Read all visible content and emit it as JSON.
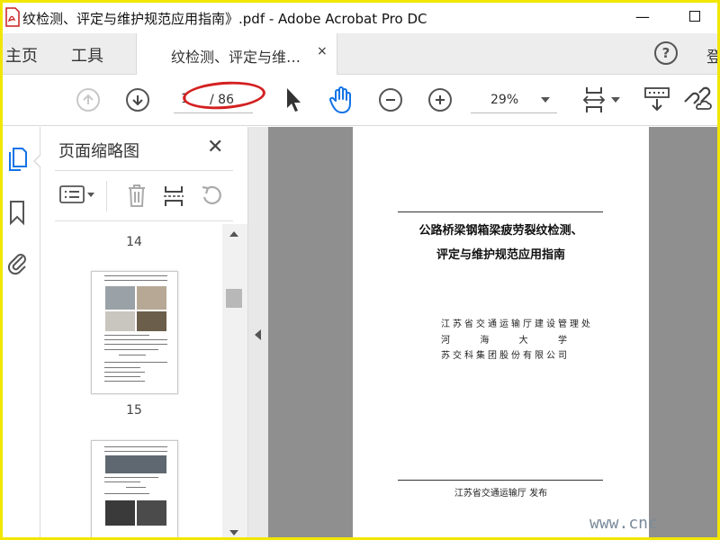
{
  "window": {
    "title": "纹检测、评定与维护规范应用指南》.pdf - Adobe Acrobat Pro DC",
    "minimize_glyph": "—"
  },
  "tabs": {
    "home": "主页",
    "tools": "工具",
    "document": "纹检测、评定与维…",
    "close_glyph": "×",
    "help_glyph": "?",
    "signin": "登"
  },
  "toolbar": {
    "current_page": "1",
    "page_total": "/ 86",
    "zoom": "29%"
  },
  "thumbnails": {
    "title": "页面缩略图",
    "close_glyph": "✕",
    "page_labels": [
      "14",
      "15"
    ]
  },
  "document": {
    "title_line1": "公路桥梁钢箱梁疲劳裂纹检测、",
    "title_line2": "评定与维护规范应用指南",
    "org_line1": "江苏省交通运输厅建设管理处",
    "org_line2_chars": [
      "河",
      "海",
      "大",
      "学"
    ],
    "org_line3": "苏交科集团股份有限公司",
    "footer": "江苏省交通运输厅   发布"
  },
  "watermark": "www.cnc",
  "colors": {
    "frame": "#f2e600",
    "annotation_circle": "#d42020",
    "accent_blue": "#1473e6",
    "canvas_gray": "#8f8f8f"
  },
  "icons": {
    "app": "acrobat-pdf-icon",
    "prev_page": "arrow-up-circle-icon",
    "next_page": "arrow-down-circle-icon",
    "select": "cursor-arrow-icon",
    "hand": "hand-tool-icon",
    "zoom_out": "minus-circle-icon",
    "zoom_in": "plus-circle-icon",
    "fit": "fit-page-icon",
    "keyboard": "keyboard-icon",
    "link": "link-cloud-icon",
    "pages": "page-thumbnails-icon",
    "bookmark": "bookmark-icon",
    "attachment": "paperclip-icon"
  }
}
